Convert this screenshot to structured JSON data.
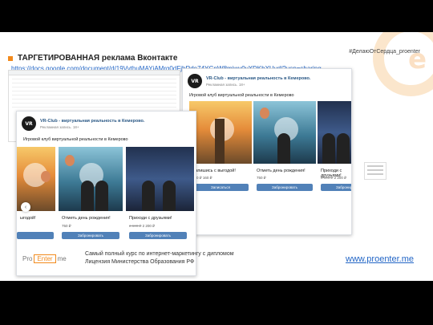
{
  "header": {
    "hashtag": "#ДелаюОтСердца_proenter",
    "title": "ТАРГЕТИРОВАННАЯ реклама Вконтакте",
    "link": "https://docs.google.com/document/d/19VythuMAYjAMrg0dFjhRde74YGnW8mjwv0vXDKhXUvd/?usp=sharing"
  },
  "ad": {
    "group_name": "VR-Club - виртуальная реальность в Кемерово.",
    "meta": "Рекламная запись. 18+",
    "description": "Игровой клуб виртуальной реальности в Кемерово"
  },
  "back_card": {
    "items": [
      {
        "caption": "Запишись с выгодой!",
        "old_price": "",
        "price": "200 ₽ 160 ₽",
        "button": "Записаться"
      },
      {
        "caption": "Отметь день рождения!",
        "old_price": "",
        "price": "750 ₽",
        "button": "Забронировать"
      },
      {
        "caption": "Приходи с друзьями!",
        "old_price": "2 600 ₽",
        "price": "2 200 ₽",
        "button": "Забронировать"
      }
    ]
  },
  "front_card": {
    "items": [
      {
        "caption": "ыгодой!",
        "price": "",
        "button": ""
      },
      {
        "caption": "Отметь день рождения!",
        "price": "750 ₽",
        "button": "Забронировать"
      },
      {
        "caption": "Приходи с друзьями!",
        "old_price": "2 600 ₽",
        "price": "2 200 ₽",
        "button": "Забронировать"
      }
    ]
  },
  "footer": {
    "logo_left": "Pro",
    "logo_box": "Enter",
    "logo_right": "me",
    "line1": "Самый полный курс по интернет-маркетингу с дипломом",
    "line2": "Лицензия Министерства Образования РФ",
    "site": "www.proenter.me"
  },
  "colors": {
    "accent": "#f28a1c",
    "link": "#2366c6",
    "vk_button": "#5181b8"
  }
}
